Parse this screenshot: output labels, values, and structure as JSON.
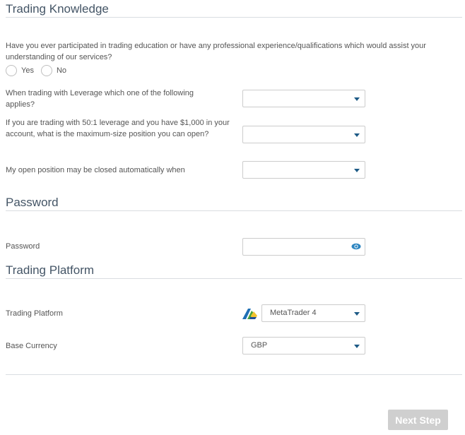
{
  "sections": {
    "trading_knowledge": "Trading Knowledge",
    "password": "Password",
    "trading_platform": "Trading Platform"
  },
  "experience_question": {
    "line1": "Have you ever participated in trading education or have any professional experience/qualifications which would assist your",
    "line2": "understanding of our services?",
    "options": [
      "Yes",
      "No"
    ]
  },
  "questions": [
    {
      "label": "When trading with Leverage which one of the following applies?",
      "value": ""
    },
    {
      "label": "If you are trading with 50:1 leverage and you have $1,000 in your account, what is the maximum-size position you can open?",
      "value": ""
    },
    {
      "label": "My open position may be closed automatically when",
      "value": ""
    }
  ],
  "password_field": {
    "label": "Password",
    "value": "",
    "icon": "eye-icon"
  },
  "platform_field": {
    "label": "Trading Platform",
    "value": "MetaTrader 4",
    "icon": "metatrader-logo-icon"
  },
  "currency_field": {
    "label": "Base Currency",
    "value": "GBP"
  },
  "next_button": {
    "label": "Next Step"
  },
  "colors": {
    "heading": "#445566",
    "caret": "#1d5a86",
    "eye": "#2e86c1",
    "button_disabled": "#cfcfcf"
  }
}
